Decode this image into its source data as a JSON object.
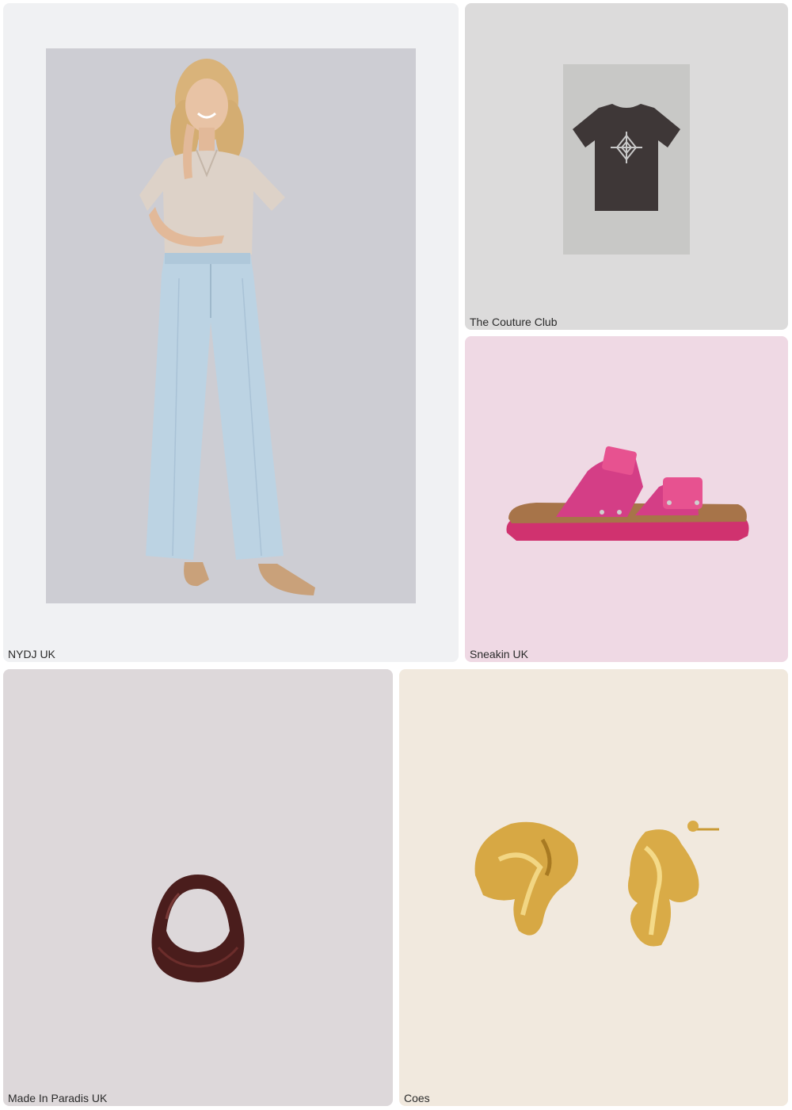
{
  "products": [
    {
      "brand": "NYDJ UK",
      "item": "woman wearing beige blouse and light wide-leg jeans"
    },
    {
      "brand": "The Couture Club",
      "item": "dark graphic t-shirt"
    },
    {
      "brand": "Sneakin UK",
      "item": "pink two-strap sandal"
    },
    {
      "brand": "Made In Paradis UK",
      "item": "brown leather crescent bag"
    },
    {
      "brand": "Coes",
      "item": "gold sculpted earrings"
    }
  ],
  "colors": {
    "card1_bg": "#f0f1f3",
    "card2_bg": "#dcdbdb",
    "card3_bg": "#efd9e4",
    "card4_bg": "#ddd8da",
    "card5_bg": "#f1e9de"
  }
}
